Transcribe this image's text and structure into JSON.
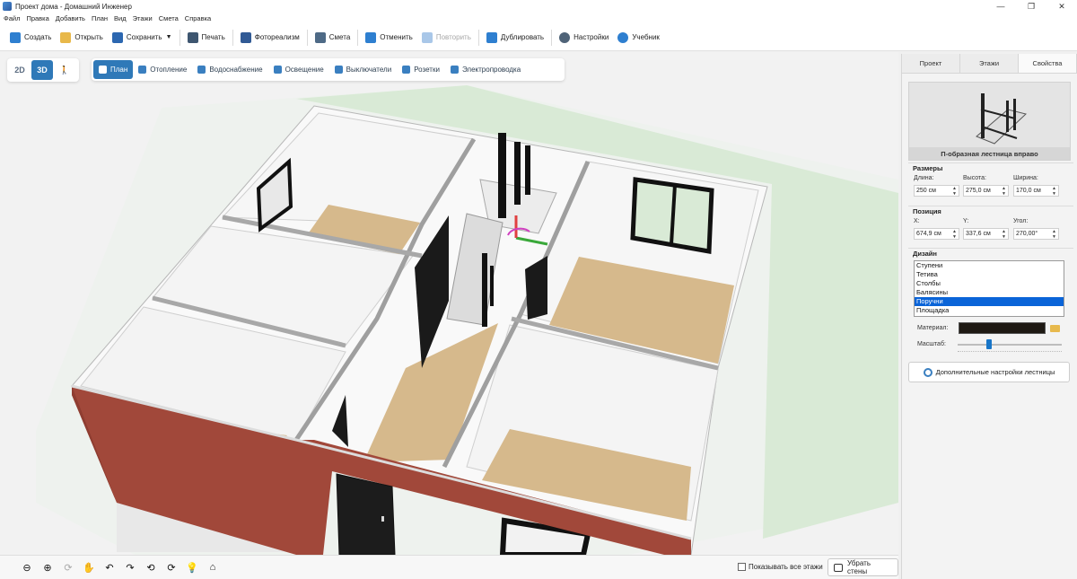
{
  "window": {
    "title": "Проект дома - Домашний Инженер",
    "controls": [
      "—",
      "❐",
      "✕"
    ]
  },
  "menu": [
    "Файл",
    "Правка",
    "Добавить",
    "План",
    "Вид",
    "Этажи",
    "Смета",
    "Справка"
  ],
  "toolbar": {
    "create": "Создать",
    "open": "Открыть",
    "save": "Сохранить",
    "print": "Печать",
    "photorealism": "Фотореализм",
    "estimate": "Смета",
    "undo": "Отменить",
    "redo": "Повторить",
    "duplicate": "Дублировать",
    "settings": "Настройки",
    "tutorial": "Учебник"
  },
  "view_switch": {
    "btn_2d": "2D",
    "btn_3d": "3D",
    "walk_icon": "person-walk-icon",
    "active": "3D"
  },
  "mode_tabs": [
    "План",
    "Отопление",
    "Водоснабжение",
    "Освещение",
    "Выключатели",
    "Розетки",
    "Электропроводка"
  ],
  "bottombar": {
    "nav_icons": [
      "zoom-out-icon",
      "zoom-in-icon",
      "rotate-360-icon",
      "hand-pan-icon",
      "rotate-left-icon",
      "rotate-right-icon",
      "orbit-left-icon",
      "orbit-right-icon",
      "light-icon",
      "home-icon"
    ],
    "show_all_floors": "Показывать все этажи",
    "show_all_floors_checked": false,
    "remove_walls": "Убрать стены"
  },
  "panel": {
    "tabs": [
      "Проект",
      "Этажи",
      "Свойства"
    ],
    "active_tab": "Свойства",
    "preview_caption": "П-образная лестница вправо",
    "dimensions": {
      "title": "Размеры",
      "length_label": "Длина:",
      "length": "250 см",
      "height_label": "Высота:",
      "height": "275,0 см",
      "width_label": "Ширина:",
      "width": "170,0 см"
    },
    "position": {
      "title": "Позиция",
      "x_label": "X:",
      "x": "674,9 см",
      "y_label": "Y:",
      "y": "337,6 см",
      "angle_label": "Угол:",
      "angle": "270,00°"
    },
    "design": {
      "title": "Дизайн",
      "items": [
        "Ступени",
        "Тетива",
        "Столбы",
        "Балясины",
        "Поручни",
        "Площадка"
      ],
      "selected": "Поручни"
    },
    "material_label": "Материал:",
    "material_color": "#1e1913",
    "scale_label": "Масштаб:",
    "scale_value": 0.3,
    "advanced_button": "Дополнительные настройки лестницы"
  },
  "colors": {
    "accent": "#2f79b8",
    "brick": "#a1483a",
    "floor": "#d6b98c",
    "grass": "#d9ead6"
  }
}
